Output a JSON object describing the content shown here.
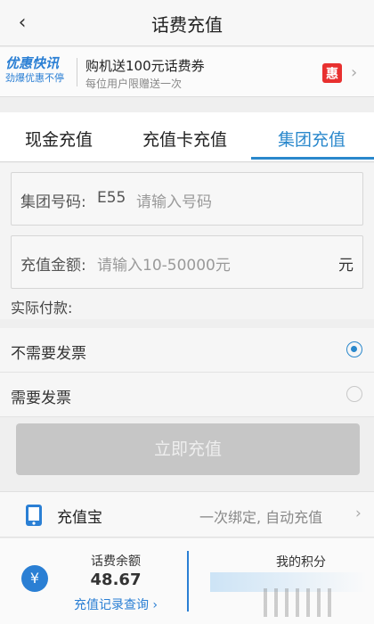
{
  "header": {
    "back_icon": "chevron-left-icon",
    "title": "话费充值"
  },
  "promo": {
    "logo_line1": "优惠快讯",
    "logo_line2": "劲爆优惠不停",
    "title": "购机送100元话费券",
    "subtitle": "每位用户限赠送一次",
    "badge_text": "惠",
    "badge_color": "#e8302f"
  },
  "tabs": [
    {
      "label": "现金充值",
      "active": false
    },
    {
      "label": "充值卡充值",
      "active": false
    },
    {
      "label": "集团充值",
      "active": true
    }
  ],
  "form": {
    "group_label": "集团号码:",
    "group_prefix": "E55",
    "group_placeholder": "请输入号码",
    "amount_label": "充值金额:",
    "amount_placeholder": "请输入10-50000元",
    "amount_unit": "元",
    "actual_pay_label": "实际付款:"
  },
  "invoice_options": [
    {
      "label": "不需要发票",
      "selected": true
    },
    {
      "label": "需要发票",
      "selected": false
    }
  ],
  "submit_label": "立即充值",
  "chongzhibao": {
    "title": "充值宝",
    "description": "一次绑定, 自动充值",
    "icon": "phone-icon"
  },
  "bottom": {
    "balance_label": "话费余额",
    "balance_value": "48.67",
    "history_link": "充值记录查询 ›",
    "points_label": "我的积分"
  },
  "colors": {
    "accent": "#2a88cc",
    "disabled_button": "#c6c6c6"
  }
}
